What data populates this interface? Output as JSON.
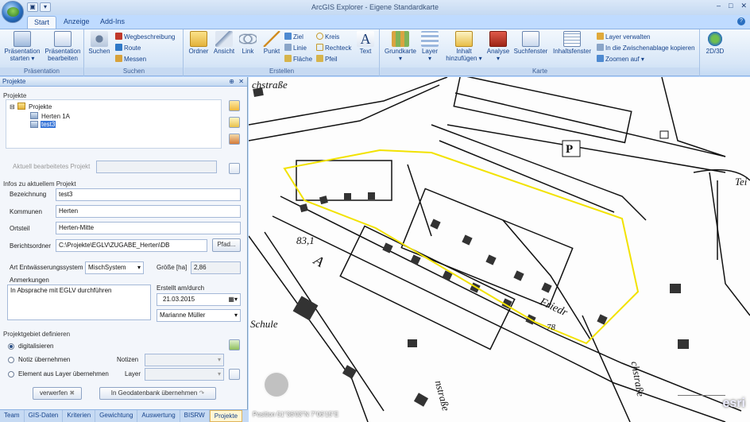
{
  "window": {
    "title": "ArcGIS Explorer - Eigene Standardkarte"
  },
  "tabs": [
    {
      "label": "Start"
    },
    {
      "label": "Anzeige"
    },
    {
      "label": "Add-Ins"
    }
  ],
  "ribbon": {
    "praesentation": {
      "label": "Präsentation",
      "start": "Präsentation starten ▾",
      "edit": "Präsentation bearbeiten"
    },
    "suchen": {
      "label": "Suchen",
      "suchen": "Suchen",
      "wegbeschreibung": "Wegbeschreibung",
      "route": "Route",
      "messen": "Messen"
    },
    "erstellen": {
      "label": "Erstellen",
      "ordner": "Ordner",
      "ansicht": "Ansicht",
      "link": "Link",
      "punkt": "Punkt",
      "ziel": "Ziel",
      "linie": "Linie",
      "flaeche": "Fläche",
      "kreis": "Kreis",
      "rechteck": "Rechteck",
      "pfeil": "Pfeil",
      "text": "Text"
    },
    "karte": {
      "label": "Karte",
      "grundkarte": "Grundkarte",
      "layer": "Layer",
      "inhalt": "Inhalt hinzufügen ▾",
      "analyse": "Analyse",
      "suchfenster": "Suchfenster",
      "inhaltsfenster": "Inhaltsfenster",
      "layer_verwalten": "Layer verwalten",
      "zwischenablage": "In die Zwischenablage kopieren",
      "zoomen": "Zoomen auf ▾",
      "view": "2D/3D"
    }
  },
  "panel": {
    "title": "Projekte",
    "projekte_section": "Projekte",
    "tree": {
      "root": "Projekte",
      "items": [
        "Herten 1A",
        "test3"
      ]
    },
    "aktuell_label": "Aktuell bearbeitetes Projekt",
    "aktuell_value": "",
    "infos_section": "Infos zu aktuellem Projekt",
    "bezeichnung_label": "Bezeichnung",
    "bezeichnung": "test3",
    "kommunen_label": "Kommunen",
    "kommunen": "Herten",
    "ortsteil_label": "Ortsteil",
    "ortsteil": "Herten-Mitte",
    "berichtsordner_label": "Berichtsordner",
    "berichtsordner": "C:\\Projekte\\EGLV\\ZUGABE_Herten\\DB",
    "pfad_button": "Pfad...",
    "art_label": "Art Entwässerungssystem",
    "art": "MischSystem",
    "groesse_label": "Größe [ha]",
    "groesse": "2,86",
    "anmerkungen_label": "Anmerkungen",
    "anmerkungen": "In Absprache mit EGLV durchführen",
    "erstellt_label": "Erstellt am/durch",
    "datum": "21.03.2015",
    "person": "Marianne Müller",
    "gebiet_section": "Projektgebiet definieren",
    "opt_digital": "digitalisieren",
    "opt_notiz": "Notiz übernehmen",
    "opt_element": "Element aus Layer übernehmen",
    "notizen_label": "Notizen",
    "layer_label": "Layer",
    "verwerfen": "verwerfen",
    "geodatenbank": "In Geodatenbank übernehmen"
  },
  "bottom_tabs": [
    "Team",
    "GIS-Daten",
    "Kriterien",
    "Gewichtung",
    "Auswertung",
    "BISRW",
    "Projekte"
  ],
  "map": {
    "labels": [
      "chstraße",
      "83,1",
      "A",
      "Schule",
      "Friedr",
      "78",
      "chstraße",
      "nstraße",
      "Tei",
      "P"
    ],
    "position": "Position 51°36'03\"N 7°06'15\"E",
    "logo": "esri"
  }
}
